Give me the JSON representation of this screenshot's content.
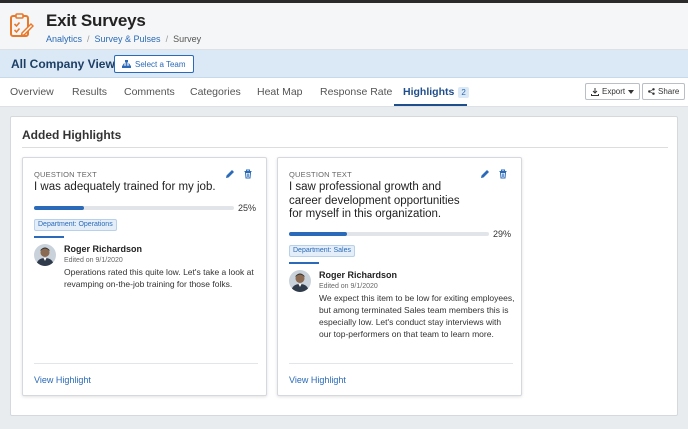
{
  "app": {
    "title": "Exit Surveys"
  },
  "breadcrumb": {
    "items": [
      "Analytics",
      "Survey & Pulses"
    ],
    "current": "Survey"
  },
  "view": {
    "title": "All Company View",
    "select_team_label": "Select a Team"
  },
  "tabs": [
    {
      "label": "Overview"
    },
    {
      "label": "Results"
    },
    {
      "label": "Comments"
    },
    {
      "label": "Categories"
    },
    {
      "label": "Heat Map"
    },
    {
      "label": "Response Rate"
    },
    {
      "label": "Highlights",
      "badge": "2",
      "active": true
    }
  ],
  "actions": {
    "export_label": "Export",
    "share_label": "Share"
  },
  "section": {
    "title": "Added Highlights"
  },
  "cards": [
    {
      "question_label": "QUESTION TEXT",
      "question": "I was adequately trained for my job.",
      "percent_label": "25%",
      "percent": 25,
      "department": "Department: Operations",
      "author": "Roger Richardson",
      "edited": "Edited on 9/1/2020",
      "comment": "Operations rated this quite low. Let's take a look at revamping on-the-job training for those folks.",
      "link": "View Highlight"
    },
    {
      "question_label": "QUESTION TEXT",
      "question": "I saw professional growth and career development opportunities for myself in this organization.",
      "percent_label": "29%",
      "percent": 29,
      "department": "Department: Sales",
      "author": "Roger Richardson",
      "edited": "Edited on 9/1/2020",
      "comment": "We expect this item to be low for exiting employees, but among terminated Sales team members this is especially low.  Let's conduct stay interviews with our top-performers on that team to learn more.",
      "link": "View Highlight"
    }
  ],
  "colors": {
    "accent": "#2a6ab8",
    "brand_icon": "#e8792b",
    "active_tab": "#1f4e8c",
    "view_bar": "#dbe8f5"
  },
  "icons": [
    "survey-icon",
    "team-icon",
    "download-icon",
    "caret-down-icon",
    "share-icon",
    "pencil-icon",
    "trash-icon"
  ]
}
